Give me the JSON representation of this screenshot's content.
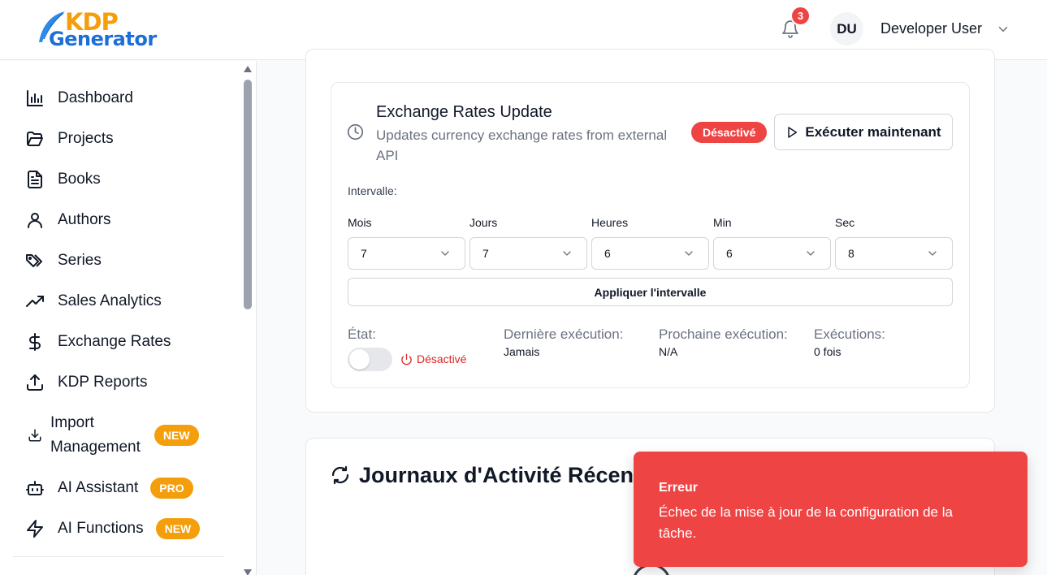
{
  "header": {
    "logo_line1": "KDP",
    "logo_line2": "Generator",
    "notification_count": "3",
    "avatar_initials": "DU",
    "username": "Developer User"
  },
  "sidebar": {
    "items": [
      {
        "label": "Dashboard",
        "icon": "bar-chart-icon"
      },
      {
        "label": "Projects",
        "icon": "folder-open-icon"
      },
      {
        "label": "Books",
        "icon": "file-text-icon"
      },
      {
        "label": "Authors",
        "icon": "user-icon"
      },
      {
        "label": "Series",
        "icon": "tags-icon"
      },
      {
        "label": "Sales Analytics",
        "icon": "trending-up-icon"
      },
      {
        "label": "Exchange Rates",
        "icon": "dollar-sign-icon"
      },
      {
        "label": "KDP Reports",
        "icon": "upload-icon"
      },
      {
        "label": "Import Management",
        "icon": "download-icon",
        "badge": "NEW"
      },
      {
        "label": "AI Assistant",
        "icon": "bot-icon",
        "badge": "PRO"
      },
      {
        "label": "AI Functions",
        "icon": "zap-icon",
        "badge": "NEW"
      }
    ],
    "import_line1": "Import",
    "import_line2": "Management"
  },
  "task": {
    "title": "Exchange Rates Update",
    "description": "Updates currency exchange rates from external API",
    "status": "Désactivé",
    "run_label": "Exécuter maintenant",
    "interval_label": "Intervalle:",
    "fields": [
      {
        "label": "Mois",
        "value": "7"
      },
      {
        "label": "Jours",
        "value": "7"
      },
      {
        "label": "Heures",
        "value": "6"
      },
      {
        "label": "Min",
        "value": "6"
      },
      {
        "label": "Sec",
        "value": "8"
      }
    ],
    "apply_label": "Appliquer l'intervalle",
    "state_label": "État:",
    "state_value": "Désactivé",
    "last_run_label": "Dernière exécution:",
    "last_run_value": "Jamais",
    "next_run_label": "Prochaine exécution:",
    "next_run_value": "N/A",
    "runs_label": "Exécutions:",
    "runs_value": "0 fois",
    "enabled": false
  },
  "logs": {
    "title": "Journaux d'Activité Récents"
  },
  "toast": {
    "title": "Erreur",
    "message": "Échec de la mise à jour de la configuration de la tâche."
  },
  "colors": {
    "accent_orange": "#f59e0b",
    "brand_blue": "#1d6fd8",
    "error_red": "#ef4444"
  }
}
